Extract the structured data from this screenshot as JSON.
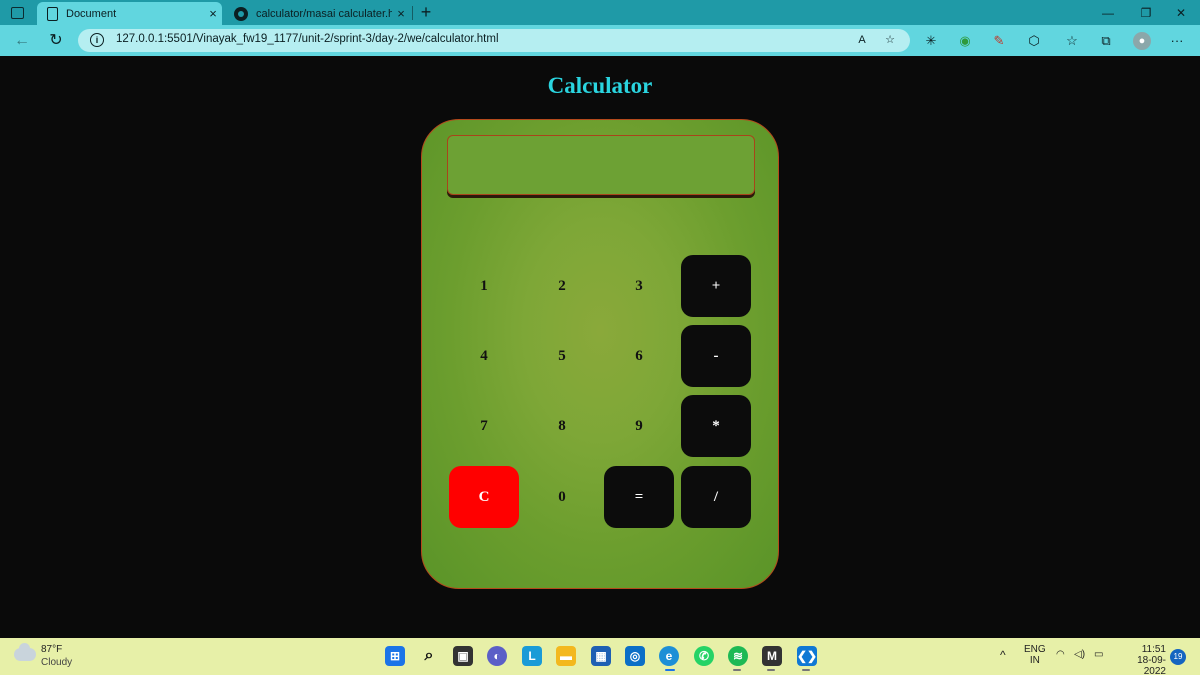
{
  "browser": {
    "tabs": [
      {
        "label": "Document",
        "active": true
      },
      {
        "label": "calculator/masai calculater.html",
        "active": false
      }
    ],
    "url": "127.0.0.1:5501/Vinayak_fw19_1177/unit-2/sprint-3/day-2/we/calculator.html",
    "tab_close": "×",
    "new_tab": "+",
    "window_controls": {
      "minimize": "—",
      "restore": "❐",
      "close": "✕"
    },
    "more_menu": "···"
  },
  "page": {
    "title": "Calculator",
    "display_value": "",
    "keys": [
      {
        "label": "1",
        "style": "plain"
      },
      {
        "label": "2",
        "style": "plain"
      },
      {
        "label": "3",
        "style": "plain"
      },
      {
        "label": "+",
        "style": "dark"
      },
      {
        "label": "4",
        "style": "plain"
      },
      {
        "label": "5",
        "style": "plain"
      },
      {
        "label": "6",
        "style": "plain"
      },
      {
        "label": "-",
        "style": "dark"
      },
      {
        "label": "7",
        "style": "plain"
      },
      {
        "label": "8",
        "style": "plain"
      },
      {
        "label": "9",
        "style": "plain"
      },
      {
        "label": "*",
        "style": "dark"
      },
      {
        "label": "C",
        "style": "red"
      },
      {
        "label": "0",
        "style": "plain"
      },
      {
        "label": "=",
        "style": "dark"
      },
      {
        "label": "/",
        "style": "dark"
      }
    ]
  },
  "taskbar": {
    "weather": {
      "temp": "87°F",
      "condition": "Cloudy"
    },
    "apps": [
      "windows-start",
      "search",
      "file-explorer-task-view",
      "teams-chat",
      "l-app",
      "file-explorer",
      "microsoft-store",
      "outlook",
      "edge",
      "whatsapp",
      "spotify",
      "m-app",
      "vscode"
    ],
    "app_glyphs": {
      "l-app": "L",
      "m-app": "M"
    },
    "language": {
      "line1": "ENG",
      "line2": "IN"
    },
    "time": "11:51",
    "date": "18-09-2022",
    "notifications": "19"
  },
  "colors": {
    "title": "#2ad4df",
    "calc_body": "#7ea737",
    "dark_key": "#0c0c0c",
    "clear_key": "#ff0000",
    "browser_tab": "#1f9aa7",
    "address_bar": "#61d6df",
    "taskbar": "#e7f0a8"
  }
}
